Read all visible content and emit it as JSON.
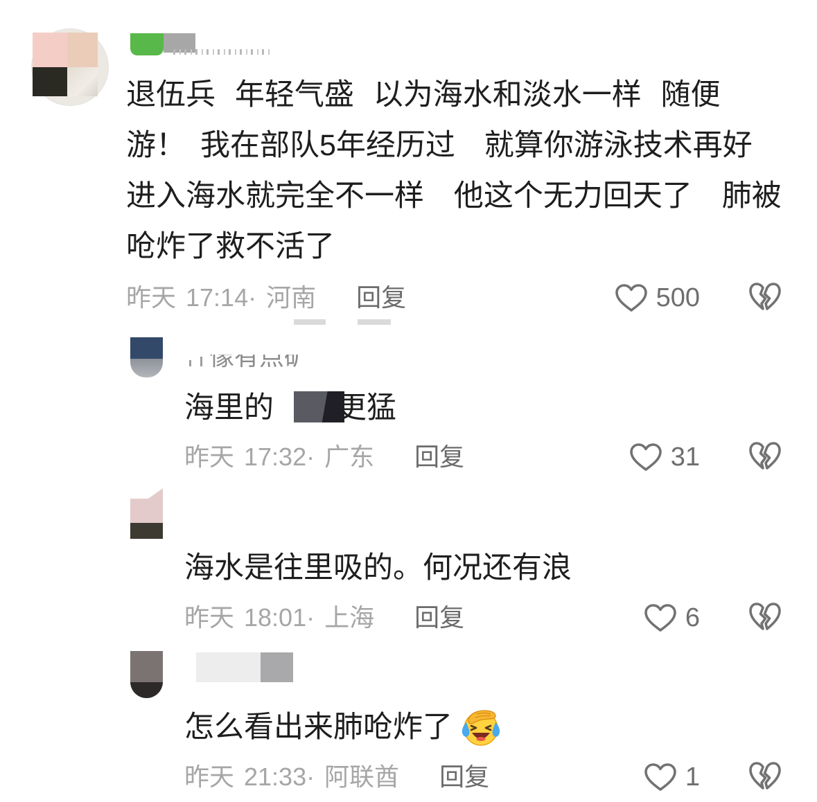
{
  "comment": {
    "text_lines": [
      "退伍兵  年轻气盛  以为海水和淡水一样  随便",
      "游！ 我在部队5年经历过  就算你游泳技术再好",
      "进入海水就完全不一样  他这个无力回天了  肺被",
      "呛炸了救不活了"
    ],
    "meta": "昨天 17:14· 河南",
    "reply_label": "回复",
    "like_count": "500"
  },
  "replies": [
    {
      "username": "像有点矿",
      "text_before": "海里的",
      "text_after": "更猛",
      "meta": "昨天 17:32· 广东",
      "reply_label": "回复",
      "like_count": "31"
    },
    {
      "text": "海水是往里吸的。何况还有浪",
      "meta": "昨天 18:01· 上海",
      "reply_label": "回复",
      "like_count": "6"
    },
    {
      "text": "怎么看出来肺呛炸了",
      "emoji": "facepalm-emoji",
      "meta": "昨天 21:33· 阿联酋",
      "reply_label": "回复",
      "like_count": "1"
    }
  ],
  "icons": {
    "like": "heart-icon",
    "dislike": "broken-heart-icon"
  },
  "colors": {
    "text": "#1e1e1e",
    "meta": "#a6a6a6",
    "action": "#6b6b6b",
    "background": "#ffffff"
  }
}
